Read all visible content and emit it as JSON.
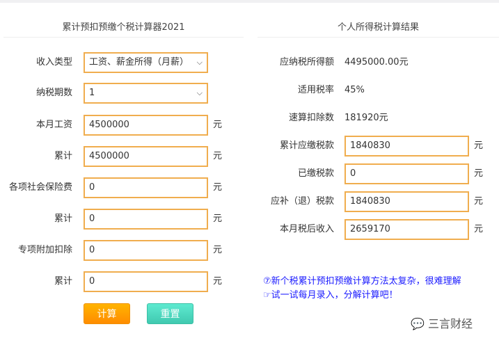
{
  "left": {
    "title": "累计预扣预缴个税计算器2021",
    "income_type": {
      "label": "收入类型",
      "value": "工资、薪金所得（月薪）"
    },
    "period": {
      "label": "纳税期数",
      "value": "1"
    },
    "fields": [
      {
        "label": "本月工资",
        "value": "4500000",
        "unit": "元"
      },
      {
        "label": "累计",
        "value": "4500000",
        "unit": "元"
      },
      {
        "label": "各项社会保险费",
        "value": "0",
        "unit": "元"
      },
      {
        "label": "累计",
        "value": "0",
        "unit": "元"
      },
      {
        "label": "专项附加扣除",
        "value": "0",
        "unit": "元"
      },
      {
        "label": "累计",
        "value": "0",
        "unit": "元"
      }
    ],
    "calc_label": "计算",
    "reset_label": "重置"
  },
  "right": {
    "title": "个人所得税计算结果",
    "static": [
      {
        "label": "应纳税所得额",
        "value": "4495000.00元"
      },
      {
        "label": "适用税率",
        "value": "45%"
      },
      {
        "label": "速算扣除数",
        "value": "181920元"
      }
    ],
    "fields": [
      {
        "label": "累计应缴税款",
        "value": "1840830",
        "unit": "元"
      },
      {
        "label": "已缴税款",
        "value": "0",
        "unit": "元"
      },
      {
        "label": "应补（退）税款",
        "value": "1840830",
        "unit": "元"
      },
      {
        "label": "本月税后收入",
        "value": "2659170",
        "unit": "元"
      }
    ],
    "note1": "⑦新个税累计预扣预缴计算方法太复杂，很难理解",
    "note2": "☞试一试每月录入，分解计算吧！"
  },
  "watermark": "三言财经"
}
